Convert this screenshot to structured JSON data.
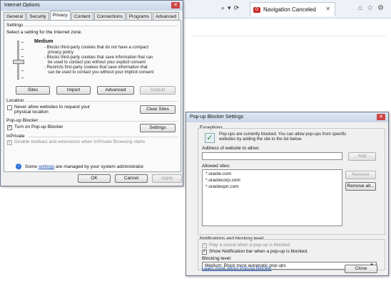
{
  "browser": {
    "tab_title": "Navigation Canceled",
    "tab_favicon_text": "O",
    "close_glyph": "✕",
    "icons": [
      "search-icon",
      "refresh-icon",
      "home-icon",
      "favorites-icon",
      "settings-icon"
    ]
  },
  "internet_options": {
    "title": "Internet Options",
    "tabs": [
      "General",
      "Security",
      "Privacy",
      "Content",
      "Connections",
      "Programs",
      "Advanced"
    ],
    "active_tab": "Privacy",
    "settings": {
      "group_label": "Settings",
      "instruction": "Select a setting for the Internet zone.",
      "level": "Medium",
      "descriptions": [
        "- Blocks third-party cookies that do not have a compact",
        "privacy policy",
        "- Blocks third-party cookies that save information that can",
        "be used to contact you without your explicit consent",
        "- Restricts first-party cookies that save information that",
        "can be used to contact you without your implicit consent"
      ],
      "buttons": {
        "sites": "Sites",
        "import": "Import",
        "advanced": "Advanced",
        "default": "Default"
      }
    },
    "location": {
      "group_label": "Location",
      "checkbox_label_1": "Never allow websites to request your",
      "checkbox_label_2": "physical location",
      "clear_sites": "Clear Sites"
    },
    "popup_blocker": {
      "group_label": "Pop-up Blocker",
      "checkbox_label": "Turn on Pop-up Blocker",
      "checked": true,
      "settings_button": "Settings"
    },
    "inprivate": {
      "group_label": "InPrivate",
      "checkbox_label": "Disable toolbars and extensions when InPrivate Browsing starts"
    },
    "admin_note_prefix": "Some ",
    "admin_note_link": "settings",
    "admin_note_suffix": " are managed by your system administrator.",
    "footer": {
      "ok": "OK",
      "cancel": "Cancel",
      "apply": "Apply"
    }
  },
  "popup_blocker_settings": {
    "title": "Pop-up Blocker Settings",
    "exceptions_label": "Exceptions",
    "exceptions_text_1": "Pop-ups are currently blocked.  You can allow pop-ups from specific",
    "exceptions_text_2": "websites by adding the site to the list below.",
    "address_label": "Address of website to allow:",
    "address_value": "",
    "add_button": "Add",
    "allowed_label": "Allowed sites:",
    "allowed_sites": [
      "*.oracle.com",
      "*.oraclecorp.com",
      "*.oraclevpn.com"
    ],
    "remove_button": "Remove",
    "remove_all_button": "Remove all...",
    "notifications_label": "Notifications and blocking level:",
    "play_sound_label": "Play a sound when a pop-up is blocked.",
    "show_bar_label": "Show Notification bar when a pop-up is blocked.",
    "show_bar_checked": true,
    "blocking_level_label": "Blocking level:",
    "blocking_level_value": "Medium: Block most automatic pop-ups",
    "learn_more_link": "Learn more about Pop-up Blocker",
    "close_button": "Close"
  }
}
